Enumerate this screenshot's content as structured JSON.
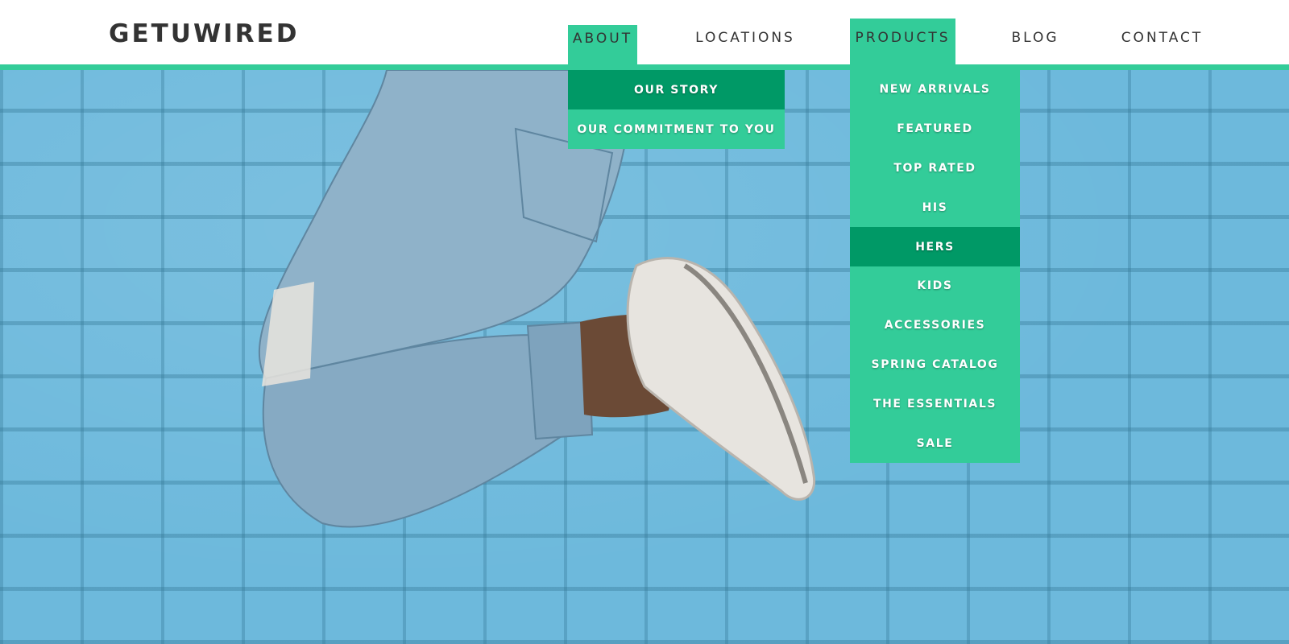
{
  "brand": {
    "logo": "GETUWIRED"
  },
  "nav": {
    "items": [
      {
        "label": "ABOUT"
      },
      {
        "label": "LOCATIONS"
      },
      {
        "label": "PRODUCTS"
      },
      {
        "label": "BLOG"
      },
      {
        "label": "CONTACT"
      }
    ]
  },
  "about_menu": {
    "items": [
      {
        "label": "OUR STORY"
      },
      {
        "label": "OUR COMMITMENT TO YOU"
      }
    ]
  },
  "products_menu": {
    "items": [
      {
        "label": "NEW ARRIVALS"
      },
      {
        "label": "FEATURED"
      },
      {
        "label": "TOP RATED"
      },
      {
        "label": "HIS"
      },
      {
        "label": "HERS"
      },
      {
        "label": "KIDS"
      },
      {
        "label": "ACCESSORIES"
      },
      {
        "label": "SPRING CATALOG"
      },
      {
        "label": "THE ESSENTIALS"
      },
      {
        "label": "SALE"
      }
    ]
  },
  "colors": {
    "accent": "#33cc99",
    "accent_dark": "#009966",
    "text": "#333333",
    "wall": "#6db9dc"
  }
}
